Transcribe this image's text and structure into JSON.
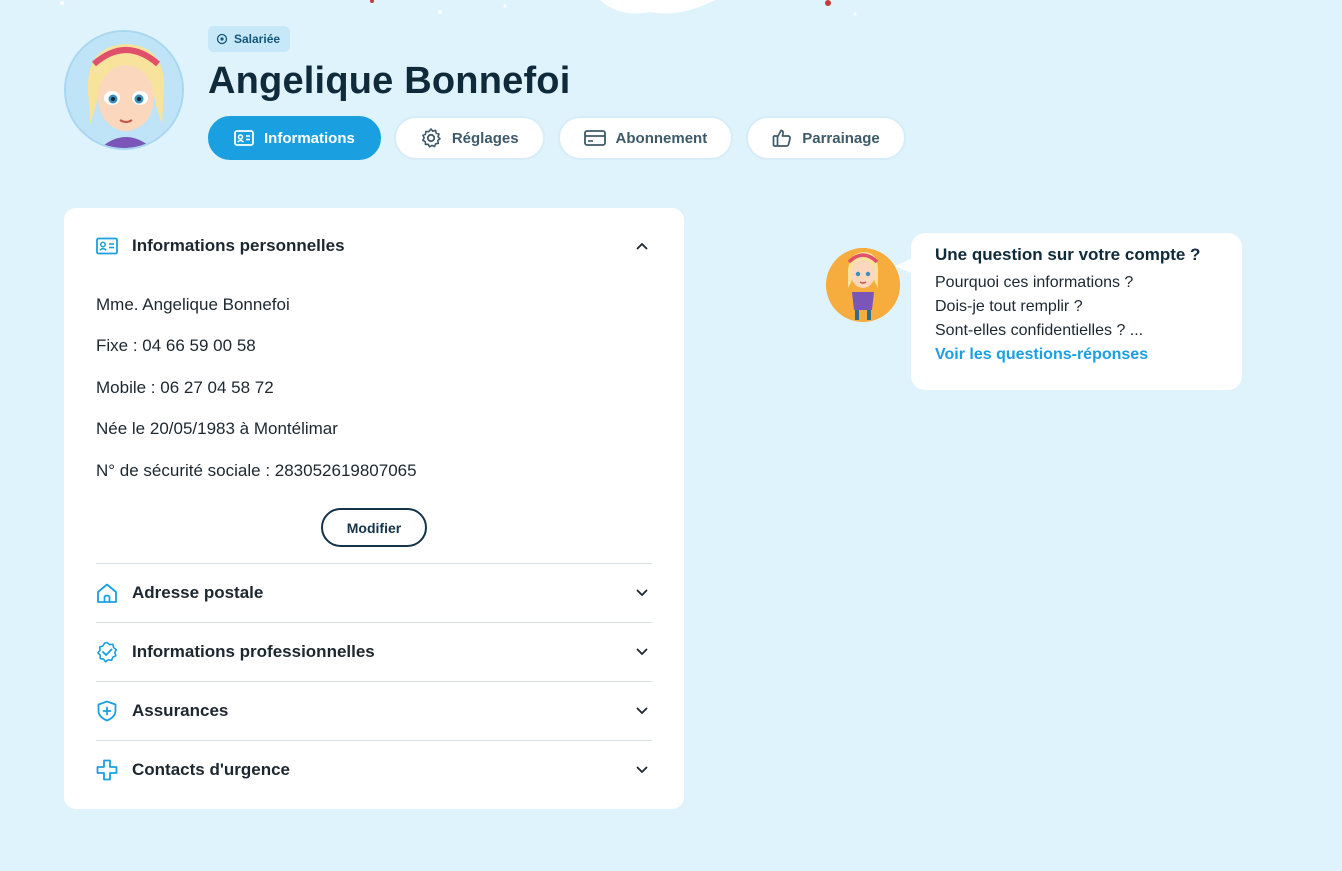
{
  "profile": {
    "badge": "Salariée",
    "name": "Angelique Bonnefoi"
  },
  "tabs": [
    {
      "label": "Informations",
      "icon": "id-card-icon",
      "active": true
    },
    {
      "label": "Réglages",
      "icon": "gear-icon",
      "active": false
    },
    {
      "label": "Abonnement",
      "icon": "credit-card-icon",
      "active": false
    },
    {
      "label": "Parrainage",
      "icon": "thumbs-up-icon",
      "active": false
    }
  ],
  "personal": {
    "title": "Informations personnelles",
    "lines": [
      "Mme. Angelique Bonnefoi",
      "Fixe : 04 66 59 00 58",
      "Mobile : 06 27 04 58 72",
      "Née le 20/05/1983 à Montélimar",
      "N° de sécurité sociale : 283052619807065"
    ],
    "modify_label": "Modifier"
  },
  "sections": [
    {
      "label": "Adresse postale",
      "icon": "house-icon"
    },
    {
      "label": "Informations professionnelles",
      "icon": "verified-badge-icon"
    },
    {
      "label": "Assurances",
      "icon": "shield-plus-icon"
    },
    {
      "label": "Contacts d'urgence",
      "icon": "medical-cross-icon"
    }
  ],
  "help": {
    "title": "Une question sur votre compte ?",
    "lines": [
      "Pourquoi ces informations ?",
      "Dois-je tout remplir ?",
      "Sont-elles confidentielles ? ..."
    ],
    "link": "Voir les questions-réponses"
  },
  "colors": {
    "background": "#dff3fc",
    "accent": "#1aa0e0",
    "dark": "#0f2a3a"
  }
}
